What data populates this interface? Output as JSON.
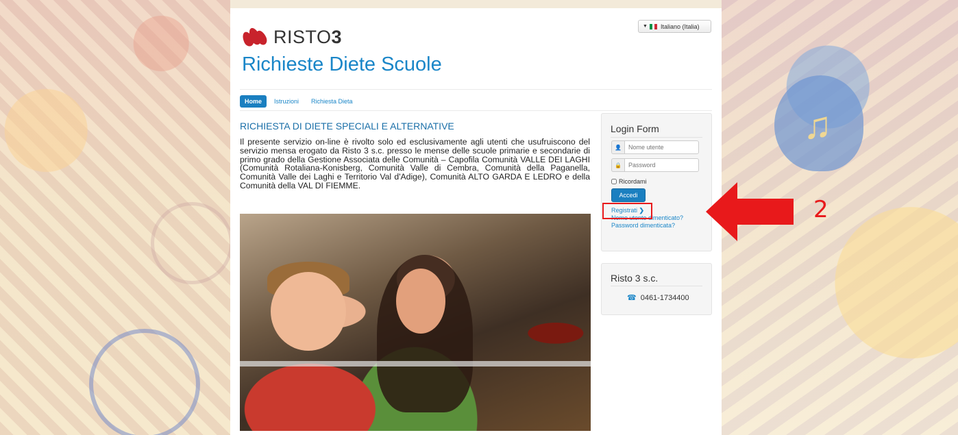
{
  "language_selector": {
    "label": "Italiano (Italia)"
  },
  "brand": {
    "logo_text_regular": "RISTO",
    "logo_text_bold": "3"
  },
  "site_title": "Richieste Diete Scuole",
  "nav": {
    "items": [
      {
        "label": "Home",
        "active": true
      },
      {
        "label": "Istruzioni",
        "active": false
      },
      {
        "label": "Richiesta Dieta",
        "active": false
      }
    ]
  },
  "article": {
    "title": "RICHIESTA DI DIETE SPECIALI E ALTERNATIVE",
    "body": "Il presente servizio on-line è rivolto solo ed esclusivamente agli utenti che usufruiscono del servizio mensa erogato da Risto 3 s.c. presso le mense delle scuole primarie e secondarie di primo grado della Gestione Associata delle Comunità – Capofila Comunità VALLE DEI LAGHI (Comunità Rotaliana-Konisberg, Comunità Valle di Cembra, Comunità della Paganella, Comunità Valle dei Laghi e Territorio Val d'Adige), Comunità ALTO GARDA E LEDRO e della Comunità della VAL DI FIEMME."
  },
  "login_form": {
    "title": "Login Form",
    "username_placeholder": "Nome utente",
    "password_placeholder": "Password",
    "remember_label": "Ricordami",
    "submit_label": "Accedi",
    "register_link": "Registrati",
    "forgot_username_link": "Nome utente dimenticato?",
    "forgot_password_link": "Password dimenticata?"
  },
  "company_module": {
    "title": "Risto 3 s.c.",
    "phone": "0461-1734400"
  },
  "annotation": {
    "step_number": "2",
    "color": "#e8191b"
  },
  "colors": {
    "brand_blue": "#1a86c8",
    "button_blue": "#1a7fc0",
    "logo_red": "#c8232c"
  }
}
